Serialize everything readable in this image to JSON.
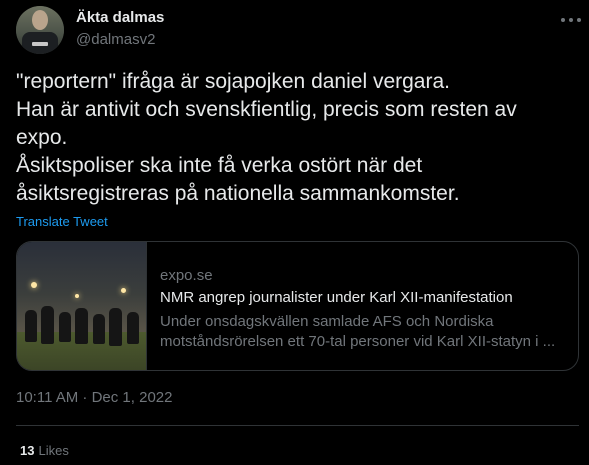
{
  "author": {
    "display_name": "Äkta dalmas",
    "handle": "@dalmasv2",
    "avatar_icon": "profile-photo"
  },
  "tweet": {
    "lines": [
      "\"reportern\" ifråga är sojapojken daniel vergara.",
      "Han är antivit och svenskfientlig, precis som resten av",
      "expo.",
      "Åsiktspoliser ska inte få verka ostört när det",
      "åsiktsregistreras på nationella sammankomster."
    ],
    "translate_label": "Translate Tweet"
  },
  "link_card": {
    "domain": "expo.se",
    "title": "NMR angrep journalister under Karl XII-manifestation",
    "description_lines": [
      "Under onsdagskvällen samlade AFS och Nordiska",
      "motståndsrörelsen ett 70-tal personer vid Karl XII-statyn i ..."
    ]
  },
  "meta": {
    "timestamp": "10:11 AM · Dec 1, 2022",
    "likes_count": "13",
    "likes_label": "Likes"
  },
  "colors": {
    "background": "#000000",
    "text_primary": "#e7e9ea",
    "text_secondary": "#71767b",
    "link": "#1d9bf0",
    "border": "#2f3336"
  }
}
